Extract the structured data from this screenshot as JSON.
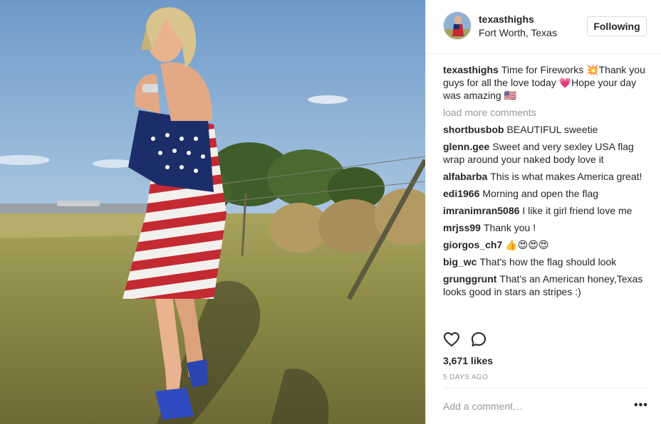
{
  "header": {
    "username": "texasthighs",
    "location": "Fort Worth, Texas",
    "follow_label": "Following"
  },
  "caption": {
    "username": "texasthighs",
    "text": "Time for Fireworks 💥Thank you guys for all the love today 💗Hope your day was amazing 🇺🇸"
  },
  "load_more": "load more comments",
  "comments": [
    {
      "user": "shortbusbob",
      "text": "BEAUTIFUL sweetie"
    },
    {
      "user": "glenn.gee",
      "text": "Sweet and very sexley USA flag wrap around your naked body love it"
    },
    {
      "user": "alfabarba",
      "text": "This is what makes America great!"
    },
    {
      "user": "edi1966",
      "text": "Morning and open the flag"
    },
    {
      "user": "imranimran5086",
      "text": "I like it girl friend love me"
    },
    {
      "user": "mrjss99",
      "text": "Thank you !"
    },
    {
      "user": "giorgos_ch7",
      "text": "👍😍😍😍"
    },
    {
      "user": "big_wc",
      "text": "That's how the flag should look"
    },
    {
      "user": "grunggrunt",
      "text": "That's an American honey,Texas looks good in stars an stripes :)"
    }
  ],
  "likes": "3,671 likes",
  "time": "5 DAYS AGO",
  "add_comment_placeholder": "Add a comment…",
  "more_label": "•••",
  "icons": {
    "like": "heart-icon",
    "comment": "comment-icon",
    "more": "more-options-icon"
  },
  "colors": {
    "text": "#262626",
    "muted": "#999999",
    "border": "#efefef"
  }
}
